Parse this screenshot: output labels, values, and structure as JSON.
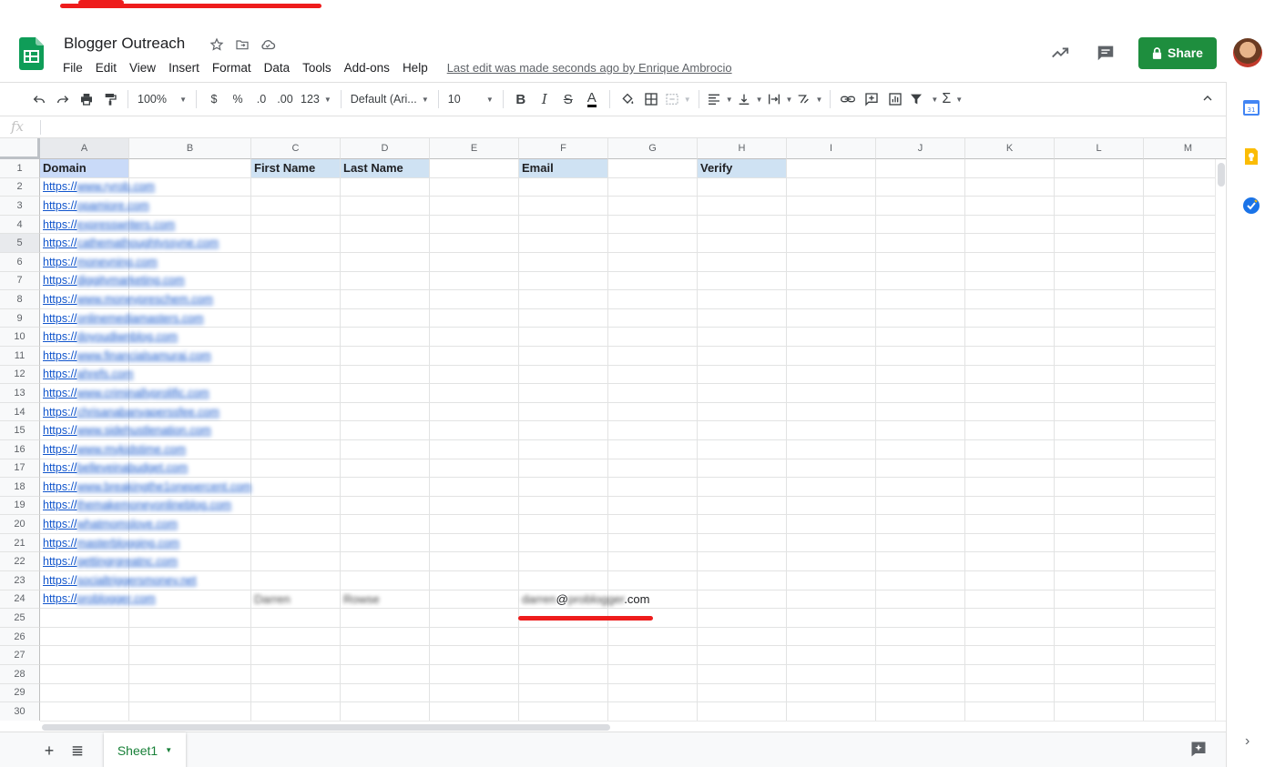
{
  "doc": {
    "title": "Blogger Outreach",
    "last_edit": "Last edit was made seconds ago by Enrique Ambrocio"
  },
  "menu": [
    "File",
    "Edit",
    "View",
    "Insert",
    "Format",
    "Data",
    "Tools",
    "Add-ons",
    "Help"
  ],
  "share_label": "Share",
  "toolbar": {
    "zoom": "100%",
    "currency": "$",
    "percent": "%",
    "dec_less": ".0",
    "dec_more": ".00",
    "num_format": "123",
    "font": "Default (Ari...",
    "font_size": "10"
  },
  "formula": {
    "fx": "fx"
  },
  "columns": [
    "A",
    "B",
    "C",
    "D",
    "E",
    "F",
    "G",
    "H",
    "I",
    "J",
    "K",
    "L",
    "M"
  ],
  "header_row": {
    "A": "Domain",
    "C": "First Name",
    "D": "Last Name",
    "F": "Email",
    "H": "Verify"
  },
  "domains": [
    "https://www.ryrob.com",
    "https://opamiore.com",
    "https://expresswriters.com",
    "https://cathemathoughtyssyne.com",
    "https://moneyning.com",
    "https://diggitymarketing.com",
    "https://www.moneypreschem.com",
    "https://onlinemediamasters.com",
    "https://doyoudiwnblog.com",
    "https://www.financialsamuraj.com",
    "https://ahrefs.com",
    "https://www.criminallyprolific.com",
    "https://chrisanabanyaperssfee.com",
    "https://www.sidehustlenation.com",
    "https://www.mykidstime.com",
    "https://belleveinabudget.com",
    "https://www.breakingthe1onepercent.com",
    "https://themakemoneyonlineblog.com",
    "https://whatmomslove.com",
    "https://masterblogging.com",
    "https://gettingrgreatnc.com",
    "https://socialtriggersmoney.net",
    "https://problogger.com"
  ],
  "row24": {
    "first_name": "Darren",
    "last_name": "Rowse",
    "email": "darren@problogger.com"
  },
  "row_numbers": [
    "1",
    "2",
    "3",
    "4",
    "5",
    "6",
    "7",
    "8",
    "9",
    "10",
    "11",
    "12",
    "13",
    "14",
    "15",
    "16",
    "17",
    "18",
    "19",
    "20",
    "21",
    "22",
    "23",
    "24",
    "25",
    "26",
    "27",
    "28",
    "29",
    "30"
  ],
  "sheet_tab": "Sheet1",
  "colors": {
    "share_green": "#1e8e3e",
    "header_fill": "#cfe2f3",
    "link_blue": "#1155cc",
    "tab_green": "#188038"
  }
}
